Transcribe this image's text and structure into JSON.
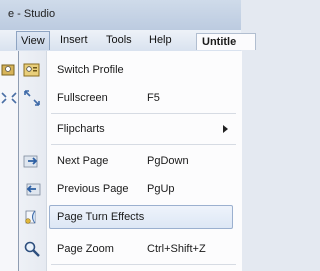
{
  "window": {
    "title": "e - Studio",
    "document_tab": "Untitle"
  },
  "menubar": {
    "items": [
      {
        "label": "View",
        "active": true
      },
      {
        "label": "Insert",
        "active": false
      },
      {
        "label": "Tools",
        "active": false
      },
      {
        "label": "Help",
        "active": false
      }
    ]
  },
  "view_menu": {
    "items": [
      {
        "label": "Switch Profile",
        "shortcut": "",
        "icon": "switch-profile-icon"
      },
      {
        "label": "Fullscreen",
        "shortcut": "F5",
        "icon": "fullscreen-icon"
      },
      {
        "label": "Flipcharts",
        "shortcut": "",
        "icon": "",
        "submenu": true
      },
      {
        "label": "Next Page",
        "shortcut": "PgDown",
        "icon": "next-page-icon"
      },
      {
        "label": "Previous Page",
        "shortcut": "PgUp",
        "icon": "previous-page-icon"
      },
      {
        "label": "Page Turn Effects",
        "shortcut": "",
        "icon": "page-turn-icon",
        "highlighted": true
      },
      {
        "label": "Page Zoom",
        "shortcut": "Ctrl+Shift+Z",
        "icon": "zoom-icon"
      }
    ]
  },
  "colors": {
    "highlight_border": "#9bb0cf",
    "menu_background": "#fcfcfd",
    "gutter": "#eef1f6"
  }
}
